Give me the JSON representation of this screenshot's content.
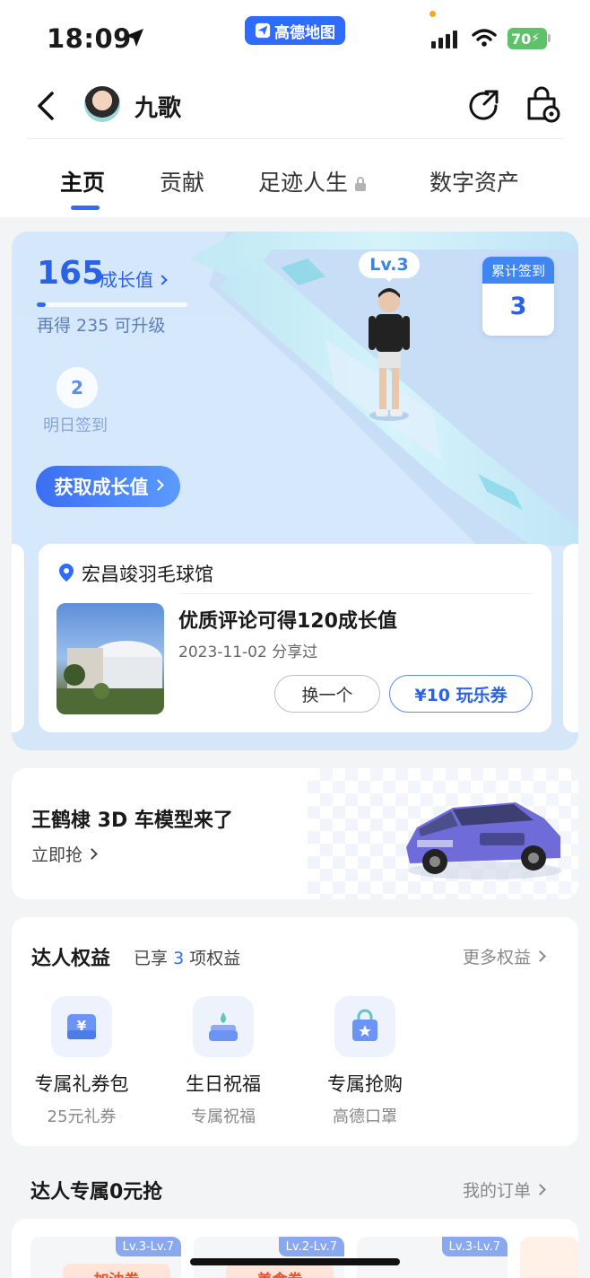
{
  "status_bar": {
    "time": "18:09",
    "app_pill": "高德地图",
    "battery": "70"
  },
  "header": {
    "user_name": "九歌"
  },
  "tabs": [
    {
      "label": "主页"
    },
    {
      "label": "贡献"
    },
    {
      "label": "足迹人生"
    },
    {
      "label": "数字资产"
    }
  ],
  "hero": {
    "growth_value": "165",
    "growth_label": "成长值",
    "growth_progress_fraction": 0.0,
    "upgrade_hint": "再得 235 可升级",
    "tomorrow_day": "2",
    "tomorrow_label": "明日签到",
    "get_growth_button": "获取成长值",
    "level": "Lv.3",
    "checkin_label": "累计签到",
    "checkin_count": "3"
  },
  "poi": {
    "name": "宏昌竣羽毛球馆",
    "title": "优质评论可得120成长值",
    "date": "2023-11-02 分享过",
    "swap_button": "换一个",
    "coupon_button": "¥10 玩乐券"
  },
  "car_banner": {
    "title": "王鹤棣 3D 车模型来了",
    "cta": "立即抢"
  },
  "perks": {
    "title": "达人权益",
    "count_prefix": "已享",
    "count": "3",
    "count_suffix": "项权益",
    "more": "更多权益",
    "items": [
      {
        "name": "专属礼券包",
        "sub": "25元礼券",
        "icon": "wallet-icon"
      },
      {
        "name": "生日祝福",
        "sub": "专属祝福",
        "icon": "cake-icon"
      },
      {
        "name": "专属抢购",
        "sub": "高德口罩",
        "icon": "shopping-bag-icon"
      }
    ]
  },
  "zero": {
    "title": "达人专属0元抢",
    "orders_link": "我的订单",
    "items": [
      {
        "badge": "Lv.3-Lv.7",
        "label": "加油券"
      },
      {
        "badge": "Lv.2-Lv.7",
        "label": "美食券"
      },
      {
        "badge": "Lv.3-Lv.7",
        "label": ""
      }
    ]
  },
  "colors": {
    "accent": "#2f6bff",
    "hero_bg": "#d5e7fb",
    "page_bg": "#f3f4f6"
  }
}
